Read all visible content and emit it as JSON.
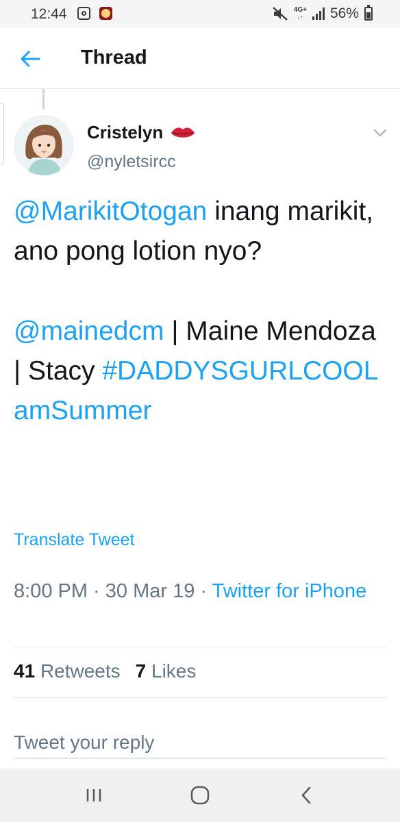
{
  "status_bar": {
    "time": "12:44",
    "network": "4G+",
    "battery": "56%"
  },
  "header": {
    "title": "Thread"
  },
  "tweet": {
    "display_name": "Cristelyn",
    "handle": "@nyletsircc",
    "text": {
      "mention1": "@MarikitOtogan",
      "line1": " inang marikit, ano pong lotion nyo?",
      "mention2": "@mainedcm",
      "line2": " | Maine Mendoza | Stacy ",
      "hashtag": "#DADDYSGURLCOOLamSummer"
    },
    "translate_label": "Translate Tweet",
    "time": "8:00 PM",
    "date": "30 Mar 19",
    "source": "Twitter for iPhone",
    "retweets_count": "41",
    "retweets_label": "Retweets",
    "likes_count": "7",
    "likes_label": "Likes"
  },
  "reply": {
    "placeholder": "Tweet your reply"
  },
  "colors": {
    "accent": "#1da1f2",
    "muted": "#657786",
    "text": "#14171a"
  }
}
